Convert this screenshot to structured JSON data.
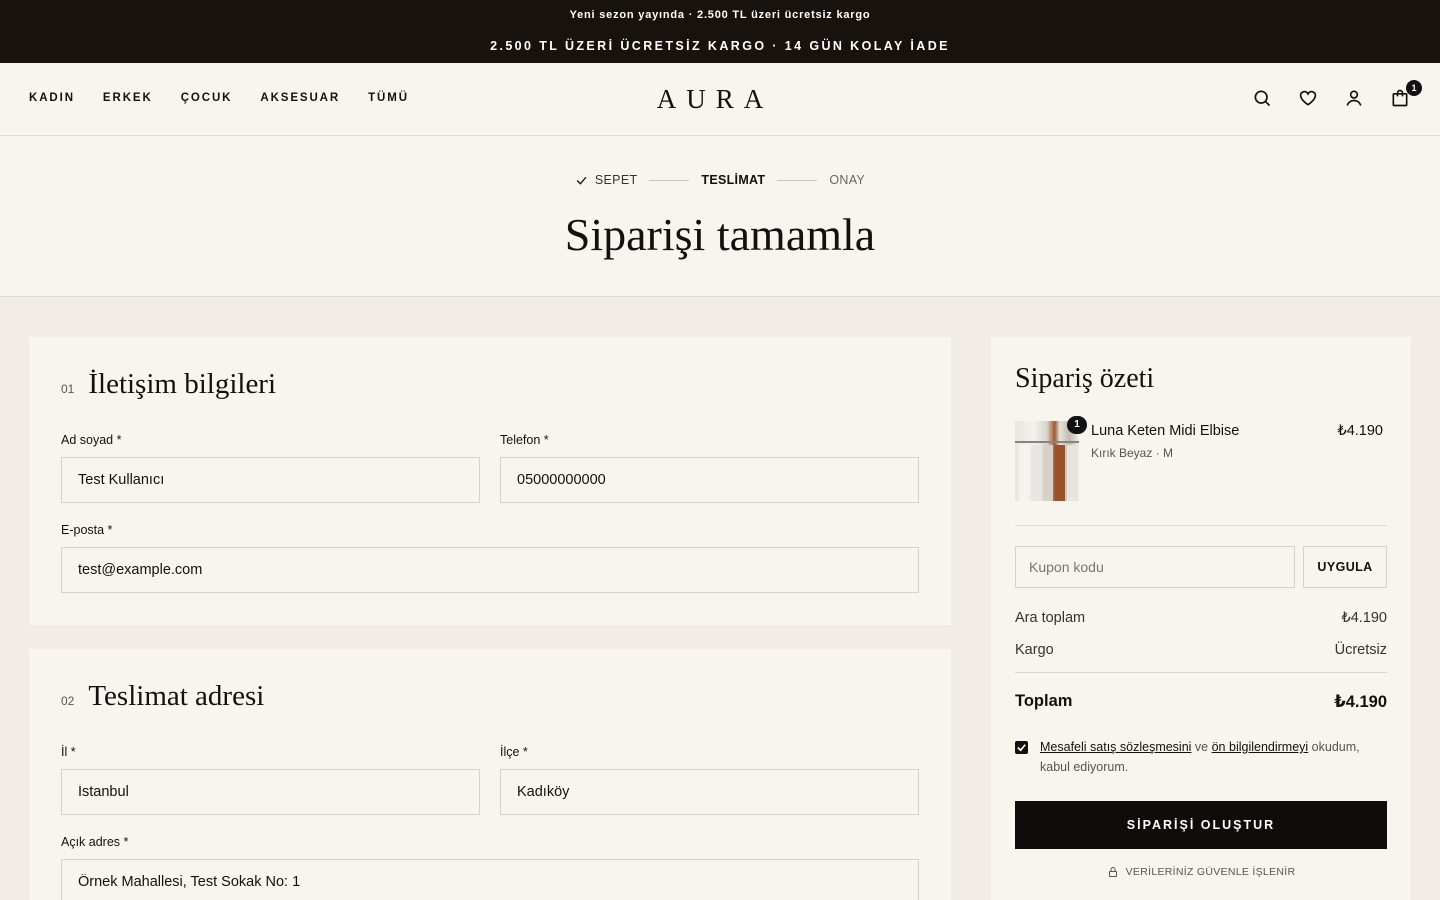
{
  "announcement": {
    "line1": "Yeni sezon yayında · 2.500 TL üzeri ücretsiz kargo",
    "line2": "2.500 TL ÜZERİ ÜCRETSİZ KARGO · 14 GÜN KOLAY İADE"
  },
  "header": {
    "nav": [
      "KADIN",
      "ERKEK",
      "ÇOCUK",
      "AKSESUAR",
      "TÜMÜ"
    ],
    "logo": "AURA",
    "cart_count": "1"
  },
  "steps": {
    "cart": "SEPET",
    "delivery": "TESLİMAT",
    "confirm": "ONAY"
  },
  "page_title": "Siparişi tamamla",
  "contact": {
    "number": "01",
    "title": "İletişim bilgileri",
    "name_label": "Ad soyad *",
    "name_value": "Test Kullanıcı",
    "phone_label": "Telefon *",
    "phone_value": "05000000000",
    "email_label": "E-posta *",
    "email_value": "test@example.com"
  },
  "address": {
    "number": "02",
    "title": "Teslimat adresi",
    "city_label": "İl *",
    "city_value": "İstanbul",
    "district_label": "İlçe *",
    "district_value": "Kadıköy",
    "full_label": "Açık adres *",
    "full_value": "Örnek Mahallesi, Test Sokak No: 1"
  },
  "summary": {
    "title": "Sipariş özeti",
    "item": {
      "qty": "1",
      "name": "Luna Keten Midi Elbise",
      "variant": "Kırık Beyaz · M",
      "price": "₺4.190"
    },
    "coupon_placeholder": "Kupon kodu",
    "apply_label": "UYGULA",
    "subtotal_label": "Ara toplam",
    "subtotal_value": "₺4.190",
    "shipping_label": "Kargo",
    "shipping_value": "Ücretsiz",
    "total_label": "Toplam",
    "total_value": "₺4.190",
    "agree": {
      "link1": "Mesafeli satış sözleşmesini",
      "mid": " ve ",
      "link2": "ön bilgilendirmeyi",
      "end": " okudum, kabul ediyorum."
    },
    "submit_label": "SİPARİŞİ OLUŞTUR",
    "secure_label": "VERİLERİNİZ GÜVENLE İŞLENİR"
  }
}
